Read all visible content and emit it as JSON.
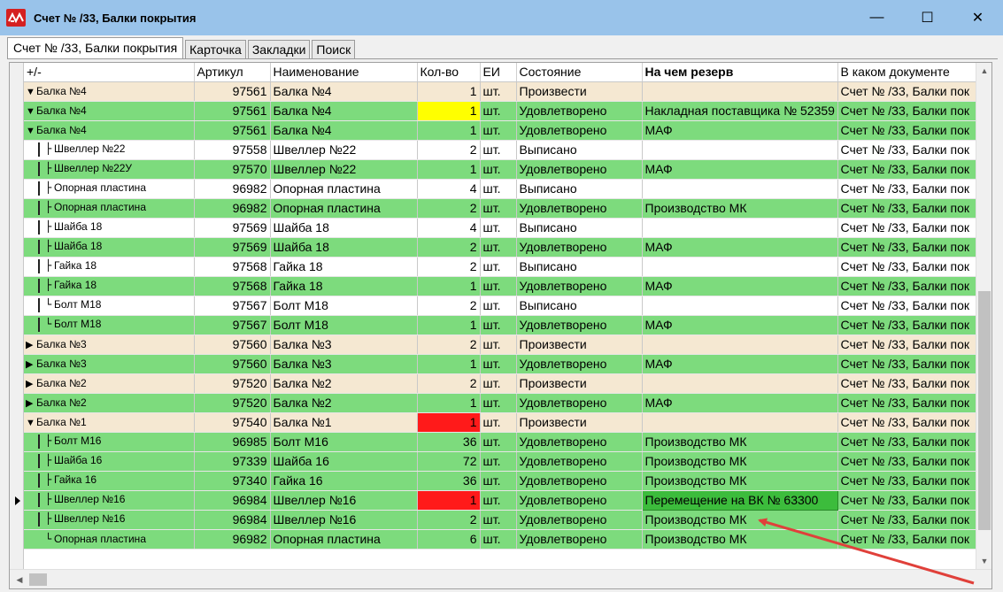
{
  "window": {
    "title": "Счет №  /33, Балки покрытия",
    "minimize_glyph": "—",
    "maximize_glyph": "☐",
    "close_glyph": "✕",
    "app_icon": "red-logo-icon"
  },
  "tabs": [
    {
      "label": "Счет №  /33, Балки покрытия",
      "active": true
    },
    {
      "label": "Карточка",
      "active": false
    },
    {
      "label": "Закладки",
      "active": false
    },
    {
      "label": "Поиск",
      "active": false
    }
  ],
  "columns": {
    "tree": "+/-",
    "article": "Артикул",
    "name": "Наименование",
    "qty": "Кол-во",
    "unit": "ЕИ",
    "state": "Состояние",
    "reserve": "На чем резерв",
    "document": "В каком документе"
  },
  "rows": [
    {
      "tree": "Балка №4",
      "article": "97561",
      "name": "Балка №4",
      "qty": "1",
      "unit": "шт.",
      "state": "Произвести",
      "reserve": "",
      "document": "Счет №  /33, Балки пок"
    },
    {
      "tree": "Балка №4",
      "article": "97561",
      "name": "Балка №4",
      "qty": "1",
      "unit": "шт.",
      "state": "Удовлетворено",
      "reserve": "Накладная поставщика № 52359",
      "document": "Счет №  /33, Балки пок"
    },
    {
      "tree": "Балка №4",
      "article": "97561",
      "name": "Балка №4",
      "qty": "1",
      "unit": "шт.",
      "state": "Удовлетворено",
      "reserve": "МАФ",
      "document": "Счет №  /33, Балки пок"
    },
    {
      "tree": "Швеллер №22",
      "article": "97558",
      "name": "Швеллер №22",
      "qty": "2",
      "unit": "шт.",
      "state": "Выписано",
      "reserve": "",
      "document": "Счет №  /33, Балки пок"
    },
    {
      "tree": "Швеллер №22У",
      "article": "97570",
      "name": "Швеллер №22",
      "qty": "1",
      "unit": "шт.",
      "state": "Удовлетворено",
      "reserve": "МАФ",
      "document": "Счет №  /33, Балки пок"
    },
    {
      "tree": "Опорная пластина",
      "article": "96982",
      "name": "Опорная пластина",
      "qty": "4",
      "unit": "шт.",
      "state": "Выписано",
      "reserve": "",
      "document": "Счет №  /33, Балки пок"
    },
    {
      "tree": "Опорная пластина",
      "article": "96982",
      "name": "Опорная пластина",
      "qty": "2",
      "unit": "шт.",
      "state": "Удовлетворено",
      "reserve": "Производство МК",
      "document": "Счет №  /33, Балки пок"
    },
    {
      "tree": "Шайба  18",
      "article": "97569",
      "name": "Шайба  18",
      "qty": "4",
      "unit": "шт.",
      "state": "Выписано",
      "reserve": "",
      "document": "Счет №  /33, Балки пок"
    },
    {
      "tree": "Шайба  18",
      "article": "97569",
      "name": "Шайба  18",
      "qty": "2",
      "unit": "шт.",
      "state": "Удовлетворено",
      "reserve": "МАФ",
      "document": "Счет №  /33, Балки пок"
    },
    {
      "tree": "Гайка 18",
      "article": "97568",
      "name": "Гайка 18",
      "qty": "2",
      "unit": "шт.",
      "state": "Выписано",
      "reserve": "",
      "document": "Счет №  /33, Балки пок"
    },
    {
      "tree": "Гайка 18",
      "article": "97568",
      "name": "Гайка 18",
      "qty": "1",
      "unit": "шт.",
      "state": "Удовлетворено",
      "reserve": "МАФ",
      "document": "Счет №  /33, Балки пок"
    },
    {
      "tree": "Болт М18",
      "article": "97567",
      "name": "Болт М18",
      "qty": "2",
      "unit": "шт.",
      "state": "Выписано",
      "reserve": "",
      "document": "Счет №  /33, Балки пок"
    },
    {
      "tree": "Болт М18",
      "article": "97567",
      "name": "Болт М18",
      "qty": "1",
      "unit": "шт.",
      "state": "Удовлетворено",
      "reserve": "МАФ",
      "document": "Счет №  /33, Балки пок"
    },
    {
      "tree": "Балка №3",
      "article": "97560",
      "name": "Балка №3",
      "qty": "2",
      "unit": "шт.",
      "state": "Произвести",
      "reserve": "",
      "document": "Счет №  /33, Балки пок"
    },
    {
      "tree": "Балка №3",
      "article": "97560",
      "name": "Балка №3",
      "qty": "1",
      "unit": "шт.",
      "state": "Удовлетворено",
      "reserve": "МАФ",
      "document": "Счет №  /33, Балки пок"
    },
    {
      "tree": "Балка №2",
      "article": "97520",
      "name": "Балка №2",
      "qty": "2",
      "unit": "шт.",
      "state": "Произвести",
      "reserve": "",
      "document": "Счет №  /33, Балки пок"
    },
    {
      "tree": "Балка №2",
      "article": "97520",
      "name": "Балка №2",
      "qty": "1",
      "unit": "шт.",
      "state": "Удовлетворено",
      "reserve": "МАФ",
      "document": "Счет №  /33, Балки пок"
    },
    {
      "tree": "Балка №1",
      "article": "97540",
      "name": "Балка №1",
      "qty": "1",
      "unit": "шт.",
      "state": "Произвести",
      "reserve": "",
      "document": "Счет №  /33, Балки пок"
    },
    {
      "tree": "Болт М16",
      "article": "96985",
      "name": "Болт М16",
      "qty": "36",
      "unit": "шт.",
      "state": "Удовлетворено",
      "reserve": "Производство МК",
      "document": "Счет №  /33, Балки пок"
    },
    {
      "tree": "Шайба  16",
      "article": "97339",
      "name": "Шайба  16",
      "qty": "72",
      "unit": "шт.",
      "state": "Удовлетворено",
      "reserve": "Производство МК",
      "document": "Счет №  /33, Балки пок"
    },
    {
      "tree": "Гайка 16",
      "article": "97340",
      "name": "Гайка 16",
      "qty": "36",
      "unit": "шт.",
      "state": "Удовлетворено",
      "reserve": "Производство МК",
      "document": "Счет №  /33, Балки пок"
    },
    {
      "tree": "Швеллер №16",
      "article": "96984",
      "name": "Швеллер №16",
      "qty": "1",
      "unit": "шт.",
      "state": "Удовлетворено",
      "reserve": "Перемещение на ВК № 63300",
      "document": "Счет №  /33, Балки пок"
    },
    {
      "tree": "Швеллер №16",
      "article": "96984",
      "name": "Швеллер №16",
      "qty": "2",
      "unit": "шт.",
      "state": "Удовлетворено",
      "reserve": "Производство МК",
      "document": "Счет №  /33, Балки пок"
    },
    {
      "tree": "Опорная пластина",
      "article": "96982",
      "name": "Опорная пластина",
      "qty": "6",
      "unit": "шт.",
      "state": "Удовлетворено",
      "reserve": "Производство МК",
      "document": "Счет №  /33, Балки пок"
    }
  ],
  "colors": {
    "titlebar": "#99c3ea",
    "row_produce": "#f5e8d2",
    "row_satisfied": "#7ddb7d",
    "row_issued": "#ffffff",
    "qty_yellow": "#ffff00",
    "qty_red": "#ff1a1a",
    "reserve_highlight": "#3cbc3c",
    "annotation_arrow": "#e0403a"
  }
}
